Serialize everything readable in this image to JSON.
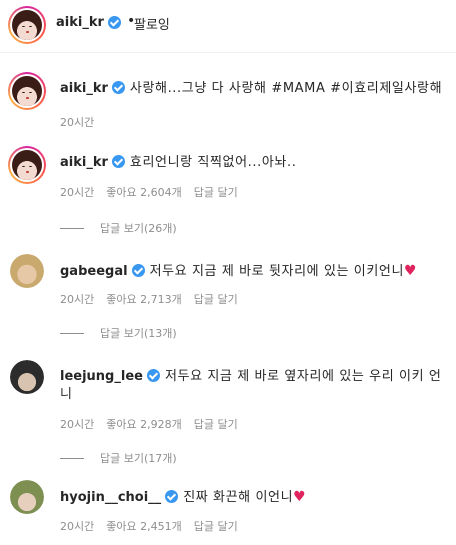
{
  "header": {
    "username": "aiki_kr",
    "separator": "•",
    "follow_label": "팔로잉"
  },
  "comments": [
    {
      "username": "aiki_kr",
      "text": "사랑해...그냥 다 사랑해 #MAMA #이효리제일사랑해",
      "time": "20시간",
      "likes": "",
      "reply_label": "",
      "view_replies": ""
    },
    {
      "username": "aiki_kr",
      "text": "효리언니랑 직찍없어...아놔..",
      "time": "20시간",
      "likes": "좋아요 2,604개",
      "reply_label": "답글 달기",
      "view_replies": "답글 보기(26개)"
    },
    {
      "username": "gabeegal",
      "text": "저두요 지금 제 바로 뒷자리에 있는 이키언니",
      "time": "20시간",
      "likes": "좋아요 2,713개",
      "reply_label": "답글 달기",
      "view_replies": "답글 보기(13개)"
    },
    {
      "username": "leejung_lee",
      "text": "저두요 지금 제 바로 옆자리에 있는 우리 이키 언니",
      "time": "20시간",
      "likes": "좋아요 2,928개",
      "reply_label": "답글 달기",
      "view_replies": "답글 보기(17개)"
    },
    {
      "username": "hyojin__choi__",
      "text": "진짜 화끈해 이언니",
      "time": "20시간",
      "likes": "좋아요 2,451개",
      "reply_label": "답글 달기",
      "view_replies": ""
    }
  ],
  "icons": {
    "verified": "verified-badge-icon",
    "heart": "red-heart-icon"
  },
  "colors": {
    "verified": "#3897f0",
    "heart": "#e0245e",
    "meta_text": "#8e8e8e"
  }
}
